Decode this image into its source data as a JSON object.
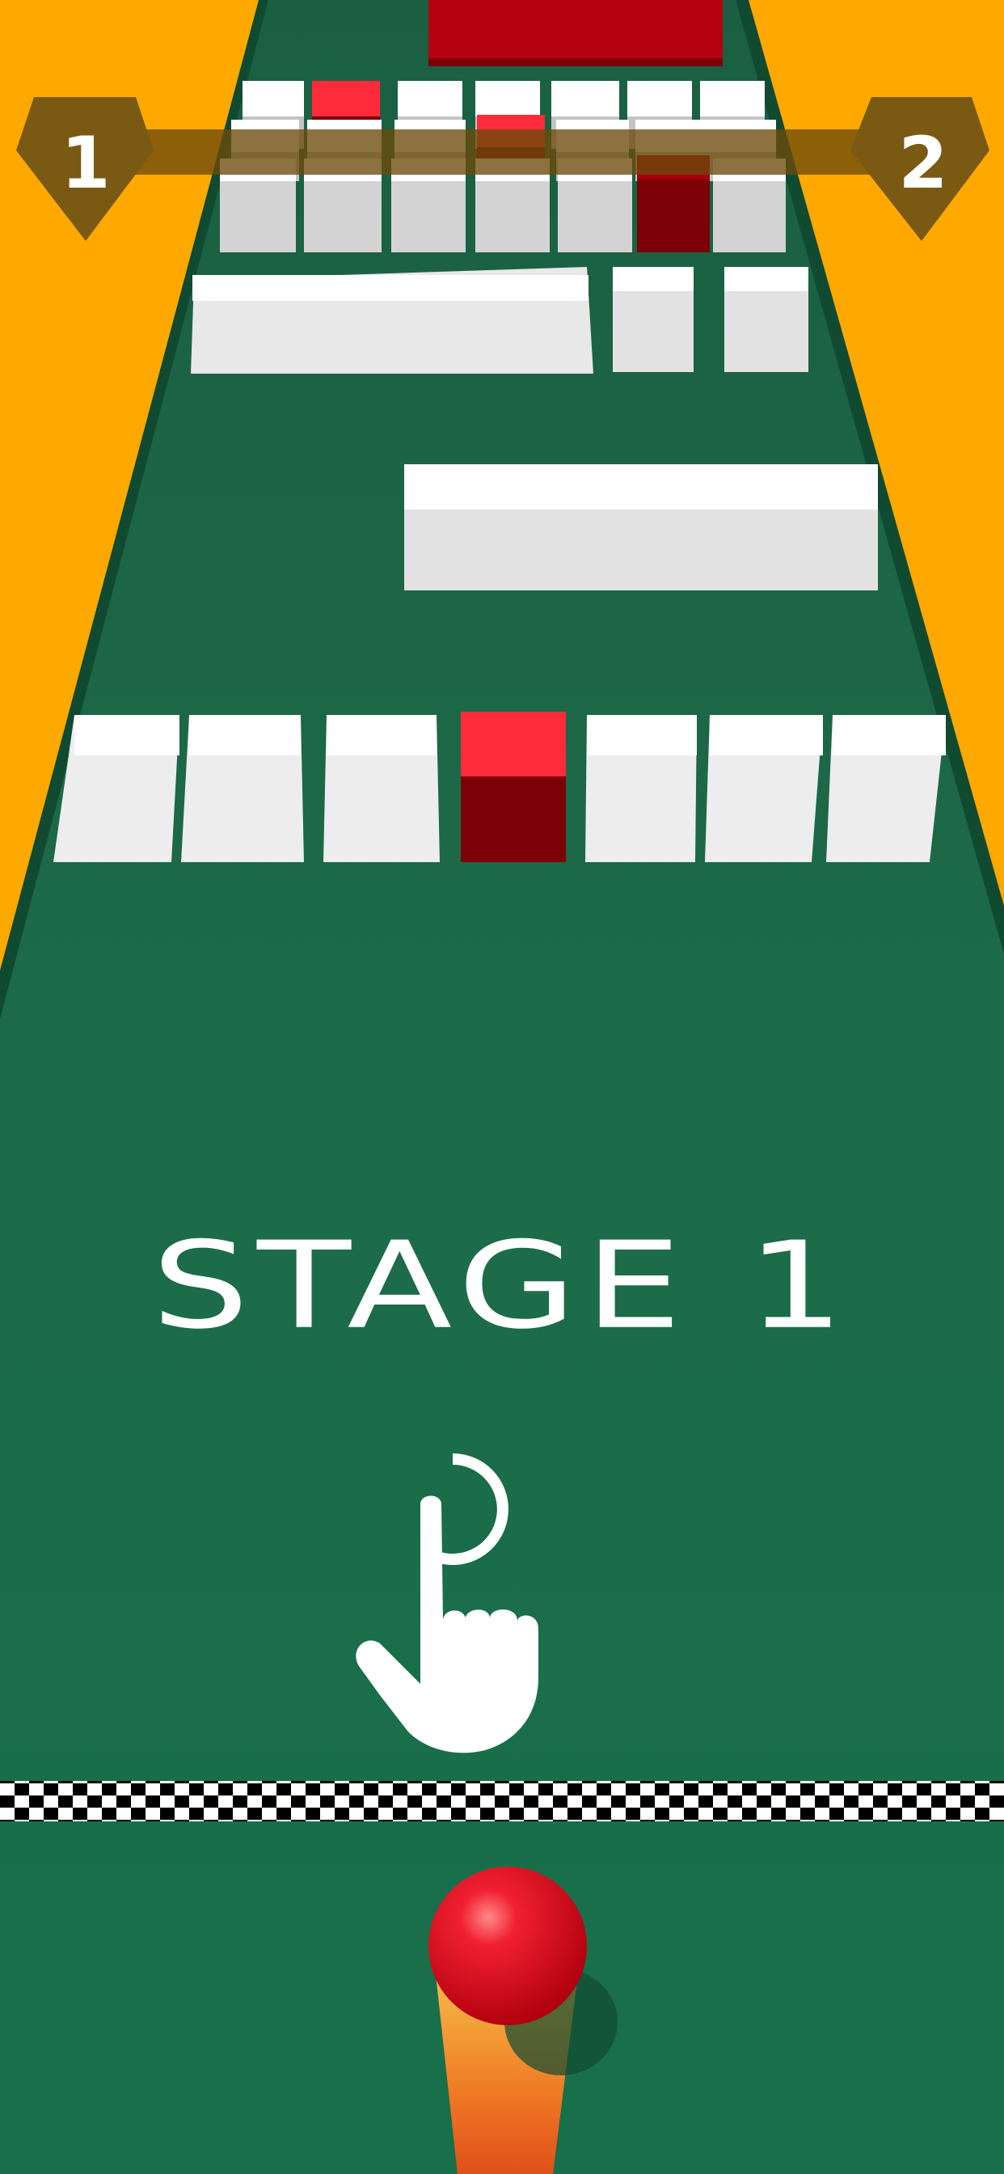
{
  "hud": {
    "current_level": "1",
    "next_level": "2"
  },
  "stage": {
    "label": "STAGE 1"
  },
  "hint": {
    "icon": "tap-hand-icon"
  },
  "colors": {
    "background": "#FFA800",
    "track": "#1B6B4B",
    "obstacle": "#FFFFFF",
    "target_block": "#FF2A3A",
    "ball": "#E4101E",
    "badge": "#7E5608",
    "trail": "#F28A25"
  },
  "player": {
    "icon": "red-ball-icon"
  }
}
